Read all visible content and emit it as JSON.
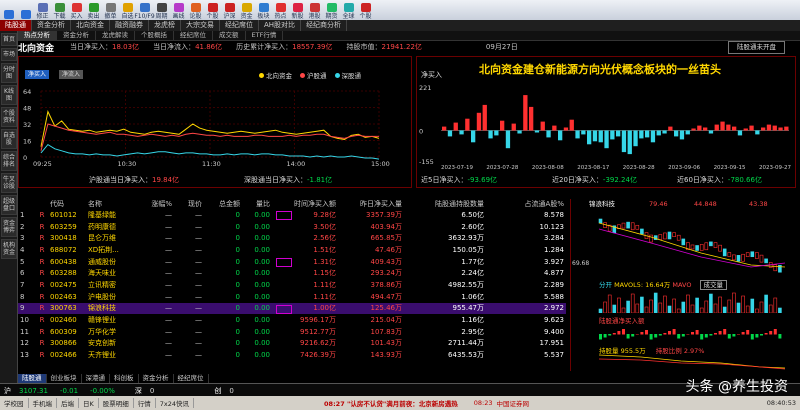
{
  "toolbar": [
    {
      "label": "",
      "icon": "back-icon",
      "color": "#2b6fd6"
    },
    {
      "label": "",
      "icon": "forward-icon",
      "color": "#2b6fd6"
    },
    {
      "label": "修正",
      "icon": "edit-icon",
      "color": "#5a6fb5"
    },
    {
      "label": "下载",
      "icon": "download-icon",
      "color": "#3a8f3a"
    },
    {
      "label": "买入",
      "icon": "buy-icon",
      "color": "#d33"
    },
    {
      "label": "卖出",
      "icon": "sell-icon",
      "color": "#2a9a2a"
    },
    {
      "label": "撤单",
      "icon": "cancel-order-icon",
      "color": "#777"
    },
    {
      "label": "自选",
      "icon": "star-icon",
      "color": "#e0a100"
    },
    {
      "label": "F10/F9",
      "icon": "info-icon",
      "color": "#3672c9"
    },
    {
      "label": "周期",
      "icon": "cycle-icon",
      "color": "#444"
    },
    {
      "label": "画线",
      "icon": "draw-icon",
      "color": "#b63ac9"
    },
    {
      "label": "论股",
      "icon": "chat-icon",
      "color": "#e06020"
    },
    {
      "label": "个股",
      "icon": "stock-icon",
      "color": "#c22"
    },
    {
      "label": "沪深",
      "icon": "market-icon",
      "color": "#c22"
    },
    {
      "label": "资金",
      "icon": "money-icon",
      "color": "#d9a800"
    },
    {
      "label": "板块",
      "icon": "sector-icon",
      "color": "#2f7cd1"
    },
    {
      "label": "热点",
      "icon": "hot-icon",
      "color": "#e03030"
    },
    {
      "label": "新股",
      "icon": "new-stock-icon",
      "color": "#d24"
    },
    {
      "label": "港股",
      "icon": "hk-icon",
      "color": "#c33"
    },
    {
      "label": "期货",
      "icon": "futures-icon",
      "color": "#2b6"
    },
    {
      "label": "全球",
      "icon": "globe-icon",
      "color": "#2aa"
    },
    {
      "label": "个股",
      "icon": "stock2-icon",
      "color": "#c22"
    }
  ],
  "tabs": [
    "陆股通",
    "资金分析",
    "北向资金",
    "融资融券",
    "龙虎榜",
    "大宗交易",
    "经纪席位",
    "AH股对比",
    "经纪商分析"
  ],
  "active_tab": 0,
  "nav": [
    "热点分析",
    "资金分析",
    "龙虎解读",
    "个股概括",
    "经纪席位",
    "成交额",
    "ETF行情"
  ],
  "left_sidebar": [
    "首页",
    "市场",
    "分时图",
    "K线图",
    "个股资料",
    "自选股",
    "综合排名",
    "牛叉诊股",
    "超级盘口",
    "资金博弈",
    "机构资金"
  ],
  "summary": {
    "title": "北向资金",
    "today_label": "当日净买入：",
    "today_value": "18.03亿",
    "net_inflow_label": "当日净流入：",
    "net_inflow_value": "41.86亿",
    "hist_label": "历史累计净买入：",
    "hist_value": "18557.39亿",
    "hold_label": "持股市值：",
    "hold_value": "21941.22亿",
    "date": "09月27日",
    "hk_button": "陆股通未开盘"
  },
  "left_chart": {
    "btn_buy": "净买入",
    "btn_inflow": "净流入",
    "legend": [
      {
        "name": "北向资金",
        "color": "#ffd700"
      },
      {
        "name": "沪股通",
        "color": "#ff4646"
      },
      {
        "name": "深股通",
        "color": "#36d6e8"
      }
    ],
    "y_ticks": [
      "64",
      "48",
      "32",
      "16",
      "0"
    ],
    "x_ticks": [
      "09:25",
      "10:30",
      "11:30",
      "14:00",
      "15:00"
    ],
    "sh_label": "沪股通当日净买入：",
    "sh_value": "19.84亿",
    "sz_label": "深股通当日净买入：",
    "sz_value": "-1.81亿"
  },
  "chart_data": [
    {
      "type": "line",
      "title": "",
      "x": [
        "09:25",
        "10:30",
        "11:30",
        "14:00",
        "15:00"
      ],
      "ylim": [
        0,
        64
      ],
      "series": [
        {
          "name": "北向资金",
          "color": "#ffd700",
          "values": [
            10,
            44,
            30,
            35,
            27,
            26,
            25,
            26,
            24,
            25,
            26,
            25,
            27,
            24,
            23,
            22,
            24,
            25,
            24,
            23,
            22,
            27,
            32,
            28,
            26,
            25,
            24,
            23,
            24,
            25,
            24,
            23,
            24,
            25,
            26,
            24,
            23,
            22,
            23,
            24,
            25,
            26,
            20,
            18,
            17,
            21,
            22,
            19,
            20,
            18
          ]
        },
        {
          "name": "沪股通",
          "color": "#ff4646",
          "values": [
            6,
            32,
            30,
            28,
            26,
            25,
            24,
            23,
            22,
            23,
            24,
            22,
            22,
            21,
            20,
            21,
            22,
            21,
            20,
            21,
            20,
            22,
            23,
            22,
            21,
            21,
            20,
            21,
            20,
            20,
            20,
            21,
            21,
            20,
            20,
            20,
            21,
            20,
            21,
            21,
            22,
            22,
            20,
            19,
            18,
            20,
            21,
            20,
            20,
            20
          ]
        },
        {
          "name": "深股通",
          "color": "#36d6e8",
          "values": [
            4,
            12,
            8,
            6,
            4,
            3,
            3,
            2,
            3,
            2,
            2,
            1,
            2,
            3,
            4,
            3,
            4,
            5,
            5,
            4,
            3,
            4,
            4,
            3,
            3,
            2,
            2,
            3,
            2,
            3,
            3,
            2,
            3,
            3,
            2,
            2,
            1,
            1,
            1,
            0,
            1,
            0,
            1,
            0,
            0,
            1,
            0,
            -1,
            -1,
            -2
          ]
        }
      ]
    },
    {
      "type": "bar",
      "title": "",
      "ylabel": "净买入",
      "ylim": [
        -155,
        221
      ],
      "categories": [
        "2023-07-19",
        "2023-07-28",
        "2023-08-08",
        "2023-08-17",
        "2023-08-28",
        "2023-09-06",
        "2023-09-15",
        "2023-09-27"
      ],
      "values": [
        20,
        -30,
        40,
        -20,
        60,
        -60,
        90,
        130,
        -40,
        -25,
        50,
        -90,
        35,
        -15,
        180,
        120,
        -10,
        45,
        -35,
        25,
        -50,
        15,
        55,
        -40,
        -20,
        -70,
        -55,
        -60,
        -90,
        -45,
        -30,
        -110,
        -120,
        -80,
        -40,
        -35,
        -60,
        -25,
        -15,
        20,
        -30,
        -45,
        -20,
        10,
        25,
        15,
        -15,
        30,
        45,
        30,
        20,
        -25,
        10,
        25,
        -20,
        15,
        30,
        25,
        15,
        20
      ]
    }
  ],
  "right_chart": {
    "label": "净买入",
    "headline": "北向资金建仓新能源方向光伏概念板块的一丝苗头",
    "y_ticks": [
      "221",
      "0",
      "-155"
    ],
    "x_ticks": [
      "2023-07-19",
      "2023-07-28",
      "2023-08-08",
      "2023-08-17",
      "2023-08-28",
      "2023-09-06",
      "2023-09-15",
      "2023-09-27"
    ],
    "d5_label": "近5日净买入：",
    "d5_value": "-93.69亿",
    "d20_label": "近20日净买入：",
    "d20_value": "-392.24亿",
    "d60_label": "近60日净买入：",
    "d60_value": "-780.66亿"
  },
  "table": {
    "headers": [
      "",
      "",
      "代码",
      "名称",
      "涨幅%",
      "现价",
      "总金额",
      "量比",
      "时间净买入额",
      "昨日净买入量",
      "陆股通持股数量",
      "占流通A股%"
    ],
    "rows": [
      {
        "i": "1",
        "t": "R",
        "code": "601012",
        "name": "隆基绿能",
        "chg": "—",
        "price": "—",
        "amt": "0",
        "vr": "0.00",
        "nb": "9.28亿",
        "nbv": "3357.39万",
        "hold": "6.50亿",
        "pct": "8.578",
        "box": true
      },
      {
        "i": "2",
        "t": "R",
        "code": "603259",
        "name": "药明康德",
        "chg": "—",
        "price": "—",
        "amt": "0",
        "vr": "0.00",
        "nb": "3.50亿",
        "nbv": "403.94万",
        "hold": "2.60亿",
        "pct": "10.123",
        "box": false
      },
      {
        "i": "3",
        "t": "R",
        "code": "300418",
        "name": "昆仑万维",
        "chg": "—",
        "price": "—",
        "amt": "0",
        "vr": "0.00",
        "nb": "2.56亿",
        "nbv": "665.85万",
        "hold": "3632.93万",
        "pct": "3.284",
        "box": false
      },
      {
        "i": "4",
        "t": "R",
        "code": "688072",
        "name": "XD拓荆...",
        "chg": "—",
        "price": "—",
        "amt": "0",
        "vr": "0.00",
        "nb": "1.51亿",
        "nbv": "47.46万",
        "hold": "150.05万",
        "pct": "1.284",
        "box": false
      },
      {
        "i": "5",
        "t": "R",
        "code": "600438",
        "name": "通威股份",
        "chg": "—",
        "price": "—",
        "amt": "0",
        "vr": "0.00",
        "nb": "1.31亿",
        "nbv": "409.43万",
        "hold": "1.77亿",
        "pct": "3.927",
        "box": true
      },
      {
        "i": "6",
        "t": "R",
        "code": "603288",
        "name": "海天味业",
        "chg": "—",
        "price": "—",
        "amt": "0",
        "vr": "0.00",
        "nb": "1.15亿",
        "nbv": "293.24万",
        "hold": "2.24亿",
        "pct": "4.877",
        "box": false
      },
      {
        "i": "7",
        "t": "R",
        "code": "002475",
        "name": "立讯精密",
        "chg": "—",
        "price": "—",
        "amt": "0",
        "vr": "0.00",
        "nb": "1.11亿",
        "nbv": "378.86万",
        "hold": "4982.55万",
        "pct": "2.289",
        "box": false
      },
      {
        "i": "8",
        "t": "R",
        "code": "002463",
        "name": "沪电股份",
        "chg": "—",
        "price": "—",
        "amt": "0",
        "vr": "0.00",
        "nb": "1.11亿",
        "nbv": "494.47万",
        "hold": "1.06亿",
        "pct": "5.588",
        "box": false
      },
      {
        "i": "9",
        "t": "R",
        "code": "300763",
        "name": "锦浪科技",
        "chg": "—",
        "price": "—",
        "amt": "0",
        "vr": "0.00",
        "nb": "1.00亿",
        "nbv": "125.46万",
        "hold": "955.47万",
        "pct": "2.972",
        "box": true,
        "sel": true
      },
      {
        "i": "10",
        "t": "R",
        "code": "002460",
        "name": "赣锋锂业",
        "chg": "—",
        "price": "—",
        "amt": "0",
        "vr": "0.00",
        "nb": "9596.17万",
        "nbv": "215.04万",
        "hold": "1.16亿",
        "pct": "9.623",
        "box": false
      },
      {
        "i": "11",
        "t": "R",
        "code": "600309",
        "name": "万华化学",
        "chg": "—",
        "price": "—",
        "amt": "0",
        "vr": "0.00",
        "nb": "9512.77万",
        "nbv": "107.83万",
        "hold": "2.95亿",
        "pct": "9.400",
        "box": false
      },
      {
        "i": "12",
        "t": "R",
        "code": "300866",
        "name": "安克创新",
        "chg": "—",
        "price": "—",
        "amt": "0",
        "vr": "0.00",
        "nb": "9216.62万",
        "nbv": "101.43万",
        "hold": "2711.44万",
        "pct": "17.951",
        "box": false
      },
      {
        "i": "13",
        "t": "R",
        "code": "002466",
        "name": "天齐锂业",
        "chg": "—",
        "price": "—",
        "amt": "0",
        "vr": "0.00",
        "nb": "7426.39万",
        "nbv": "143.93万",
        "hold": "6435.53万",
        "pct": "5.537",
        "box": false
      }
    ]
  },
  "side": {
    "stock": "锦浪科技",
    "p1": "79.46",
    "p2": "44.848",
    "p3": "43.38",
    "k_labels": [
      "69.68",
      "1"
    ],
    "indicator": "分开",
    "ma_label": "MAVOL5: 16.64万",
    "ma2": "MAVO",
    "vol_label": "成交量",
    "flow_label": "陆股通净买入额",
    "hold_label": "持股量 955.5万",
    "ratio_label": "持股比例 2.97%"
  },
  "bottom_tabs": [
    "陆股通",
    "创业板块",
    "深港通",
    "科创板",
    "资金分析",
    "经纪席位"
  ],
  "status": {
    "sh_label": "沪",
    "sh_val": "3107.31",
    "sh_chg": "-0.01",
    "sh_pct": "-0.00%",
    "sz_label": "深",
    "sz_val": "0",
    "cy_label": "创",
    "cy_val": "0",
    "news": "08:27 \"认房不认贷\"满月前夜：北京新房遇热",
    "time": "08:23",
    "site": "中国证券网",
    "clock": "08:40:53"
  },
  "status2": [
    "学校园",
    "手机端",
    "后端",
    "日K",
    "股票明细",
    "行情",
    "7x24快讯"
  ],
  "watermark": "头条 @养生投资"
}
